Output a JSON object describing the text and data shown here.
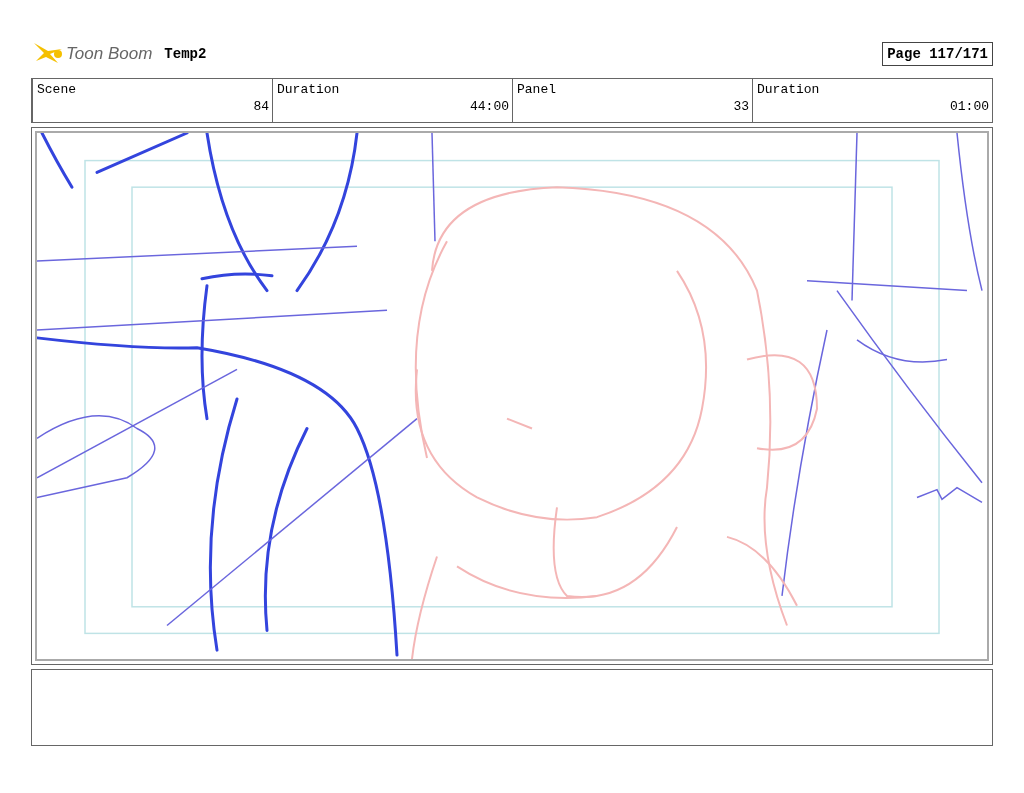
{
  "header": {
    "brand": "Toon Boom",
    "project": "Temp2",
    "page": "Page 117/171"
  },
  "info_table": {
    "columns": [
      "Scene",
      "Duration",
      "Panel",
      "Duration"
    ],
    "rows": [
      [
        "84",
        "44:00",
        "33",
        "01:00"
      ]
    ]
  }
}
